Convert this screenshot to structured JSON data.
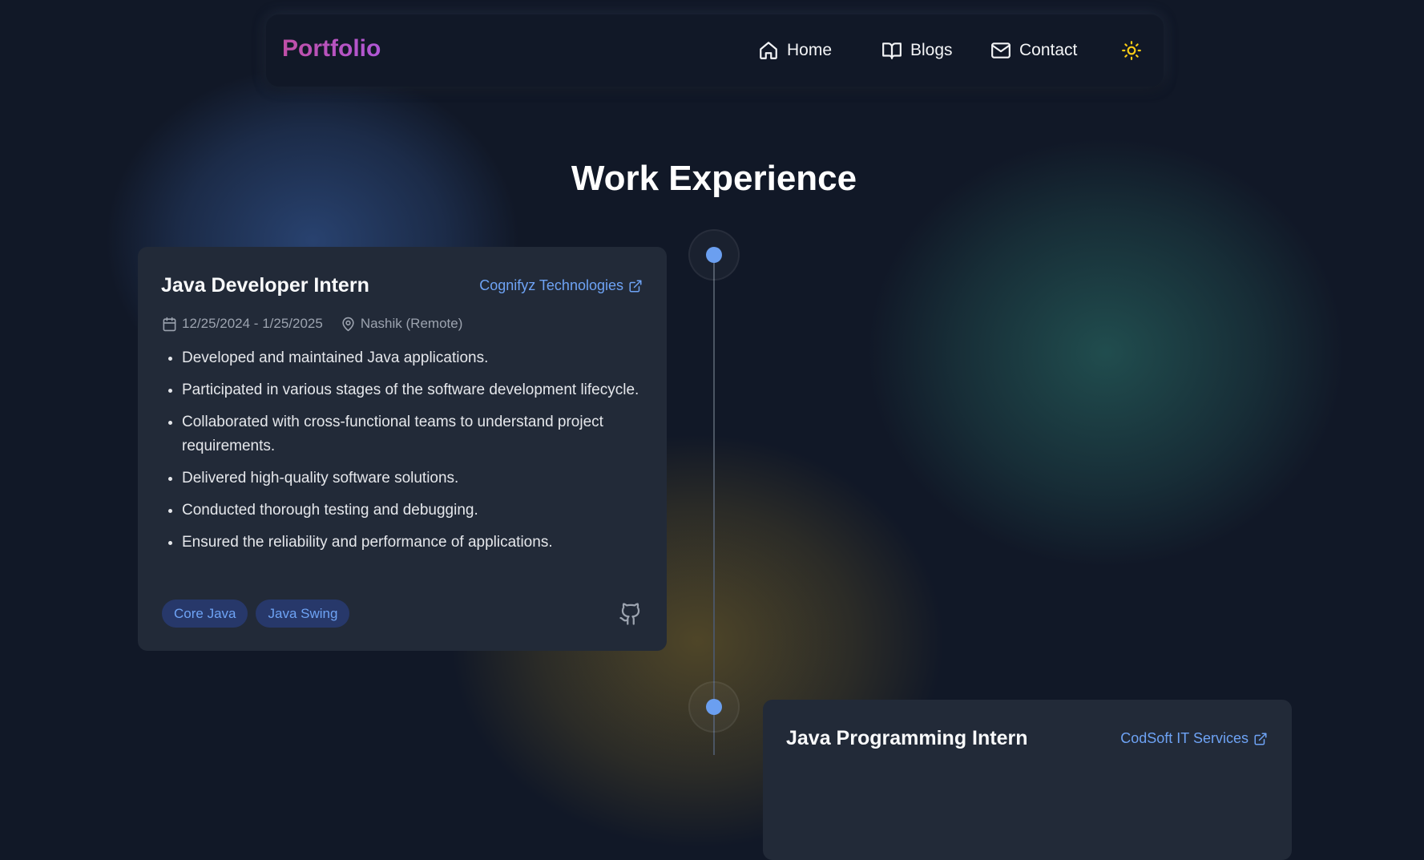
{
  "nav": {
    "brand": "Portfolio",
    "items": [
      {
        "label": "Home",
        "icon": "home-icon"
      },
      {
        "label": "Blogs",
        "icon": "book-open-icon"
      },
      {
        "label": "Contact",
        "icon": "mail-icon"
      }
    ],
    "theme_icon": "sun-icon"
  },
  "section": {
    "title": "Work Experience"
  },
  "experiences": [
    {
      "title": "Java Developer Intern",
      "company": "Cognifyz Technologies",
      "dates": "12/25/2024 - 1/25/2025",
      "location": "Nashik (Remote)",
      "duties": [
        "Developed and maintained Java applications.",
        "Participated in various stages of the software development lifecycle.",
        "Collaborated with cross-functional teams to understand project requirements.",
        "Delivered high-quality software solutions.",
        "Conducted thorough testing and debugging.",
        "Ensured the reliability and performance of applications."
      ],
      "tags": [
        "Core Java",
        "Java Swing"
      ]
    },
    {
      "title": "Java Programming Intern",
      "company": "CodSoft IT Services"
    }
  ],
  "colors": {
    "accent": "#6ea3f5",
    "background": "#111827",
    "card": "#222a38",
    "brand_gradient_start": "#c04fa7",
    "brand_gradient_end": "#b057d6",
    "sun": "#facc15"
  }
}
